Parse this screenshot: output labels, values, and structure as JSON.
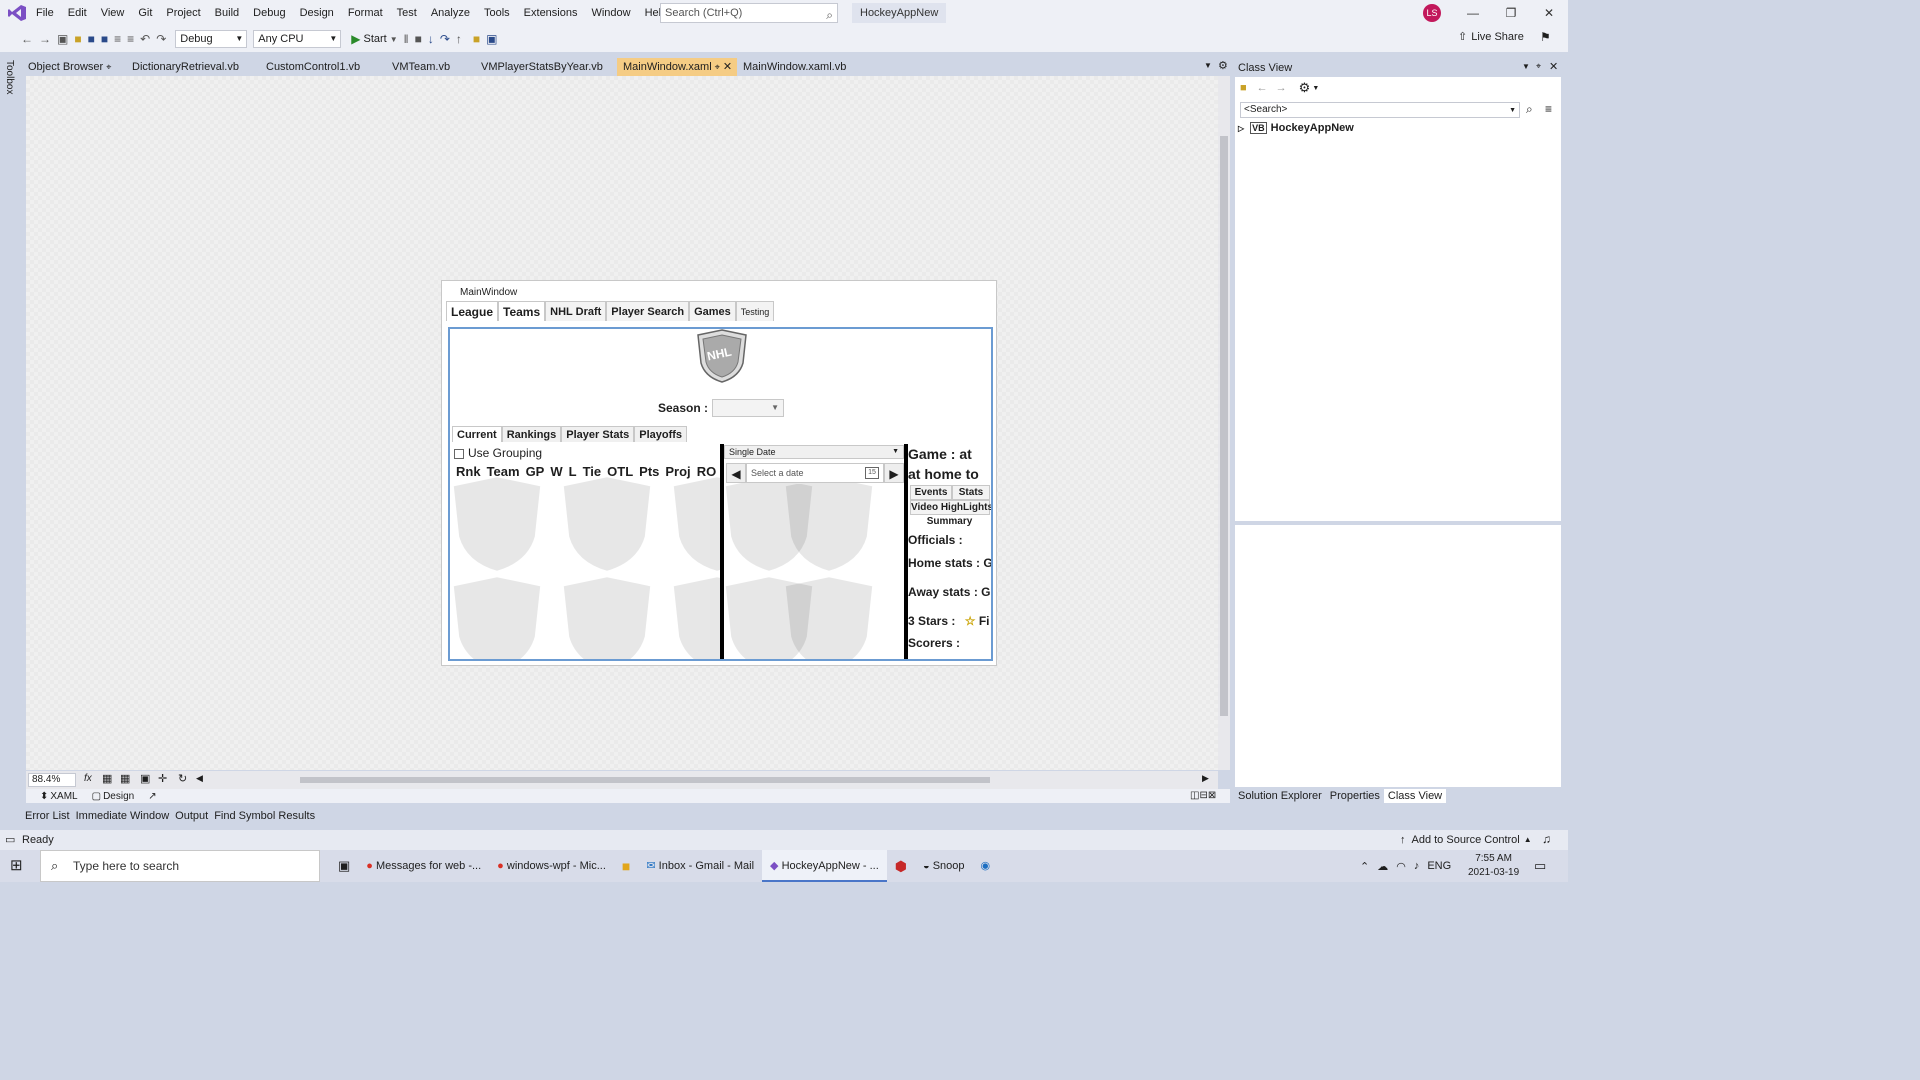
{
  "menubar": {
    "menus": [
      "File",
      "Edit",
      "View",
      "Git",
      "Project",
      "Build",
      "Debug",
      "Design",
      "Format",
      "Test",
      "Analyze",
      "Tools",
      "Extensions",
      "Window",
      "Help"
    ],
    "search_placeholder": "Search (Ctrl+Q)",
    "solution_title": "HockeyAppNew",
    "avatar_initials": "LS"
  },
  "toolbar": {
    "configuration": "Debug",
    "platform": "Any CPU",
    "start_label": "Start",
    "live_share": "Live Share"
  },
  "left_strip": {
    "toolbox": "Toolbox"
  },
  "doc_tabs": [
    {
      "label": "Object Browser",
      "active": false
    },
    {
      "label": "DictionaryRetrieval.vb",
      "active": false
    },
    {
      "label": "CustomControl1.vb",
      "active": false
    },
    {
      "label": "VMTeam.vb",
      "active": false
    },
    {
      "label": "VMPlayerStatsByYear.vb",
      "active": false
    },
    {
      "label": "MainWindow.xaml",
      "active": true
    },
    {
      "label": "MainWindow.xaml.vb",
      "active": false
    }
  ],
  "designer": {
    "zoom": "88.4%",
    "view_xaml": "XAML",
    "view_design": "Design"
  },
  "wpf_window": {
    "title": "MainWindow",
    "tabs": [
      "League",
      "Teams",
      "NHL Draft",
      "Player Search",
      "Games",
      "Testing"
    ],
    "logo_text": "NHL",
    "season_label": "Season :",
    "subtabs": [
      "Current",
      "Rankings",
      "Player Stats",
      "Playoffs"
    ],
    "use_grouping": "Use Grouping",
    "columns": [
      "Rnk",
      "Team",
      "GP",
      "W",
      "L",
      "Tie",
      "OTL",
      "Pts",
      "Proj",
      "RO"
    ],
    "date_mode": "Single Date",
    "date_placeholder": "Select a date",
    "calendar_day": "15",
    "game": {
      "header": "Game :  at",
      "subheader": "at home to",
      "events_btn": "Events",
      "stats_btn": "Stats",
      "video_btn": "Video HighLights",
      "summary": "Summary",
      "officials": "Officials :",
      "home_stats": "Home stats : G",
      "away_stats": "Away stats : Go",
      "three_stars": "3 Stars :",
      "three_stars_value": "Fi",
      "scorers": "Scorers :"
    }
  },
  "class_view": {
    "title": "Class View",
    "search_placeholder": "<Search>",
    "root_node": "HockeyAppNew"
  },
  "right_tabs": [
    "Solution Explorer",
    "Properties",
    "Class View"
  ],
  "bottom_tabs": [
    "Error List",
    "Immediate Window",
    "Output",
    "Find Symbol Results"
  ],
  "statusbar": {
    "status": "Ready",
    "source_control": "Add to Source Control"
  },
  "taskbar": {
    "search_placeholder": "Type here to search",
    "apps": [
      "Messages for web -...",
      "windows-wpf - Mic...",
      "",
      "Inbox - Gmail - Mail",
      "HockeyAppNew - ...",
      "",
      "Snoop",
      ""
    ],
    "language": "ENG",
    "time": "7:55 AM",
    "date": "2021-03-19"
  }
}
